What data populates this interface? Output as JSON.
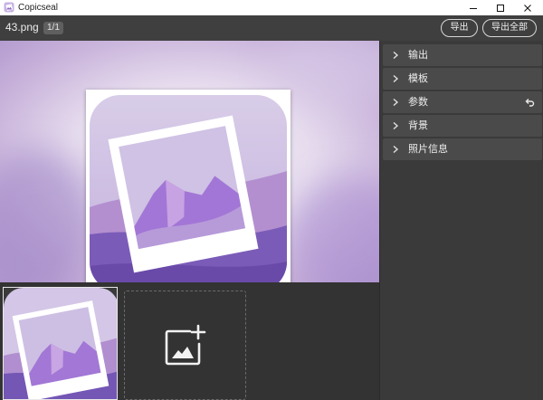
{
  "window": {
    "title": "Copicseal",
    "icon": "copicseal-app-icon",
    "controls": [
      "minimize-icon",
      "maximize-icon",
      "close-icon"
    ]
  },
  "toolbar": {
    "filename": "43.png",
    "page_indicator": "1/1",
    "export_label": "导出",
    "export_all_label": "导出全部"
  },
  "panel": {
    "sections": [
      {
        "label": "输出",
        "icon": "chevron-right-icon"
      },
      {
        "label": "模板",
        "icon": "chevron-right-icon"
      },
      {
        "label": "参数",
        "icon": "chevron-right-icon",
        "action_icon": "undo-icon"
      },
      {
        "label": "背景",
        "icon": "chevron-right-icon"
      },
      {
        "label": "照片信息",
        "icon": "chevron-right-icon"
      }
    ]
  },
  "thumbnails": {
    "add_icon": "add-image-icon"
  },
  "colors": {
    "titlebar": "#ffffff",
    "toolbar": "#3f3f3f",
    "panel": "#3a3a3a",
    "panel_row": "#4a4a4a",
    "strip": "#333333",
    "accent_purple": "#a98fd6"
  }
}
